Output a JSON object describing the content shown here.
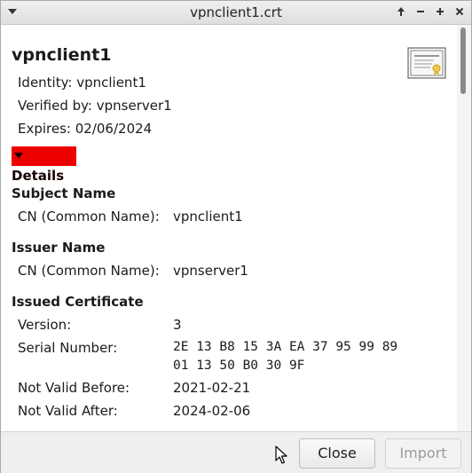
{
  "window": {
    "title": "vpnclient1.crt"
  },
  "certificate": {
    "name": "vpnclient1",
    "identity": "Identity: vpnclient1",
    "verified_by": "Verified by: vpnserver1",
    "expires": "Expires: 02/06/2024",
    "details_label": "Details"
  },
  "subject": {
    "heading": "Subject Name",
    "cn_label": "CN (Common Name):",
    "cn_value": "vpnclient1"
  },
  "issuer": {
    "heading": "Issuer Name",
    "cn_label": "CN (Common Name):",
    "cn_value": "vpnserver1"
  },
  "issued": {
    "heading": "Issued Certificate",
    "version_label": "Version:",
    "version_value": "3",
    "serial_label": "Serial Number:",
    "serial_line1": "2E 13 B8 15 3A EA 37 95 99 89",
    "serial_line2": "01 13 50 B0 30 9F",
    "not_before_label": "Not Valid Before:",
    "not_before_value": "2021-02-21",
    "not_after_label": "Not Valid After:",
    "not_after_value": "2024-02-06"
  },
  "buttons": {
    "close": "Close",
    "import": "Import"
  }
}
